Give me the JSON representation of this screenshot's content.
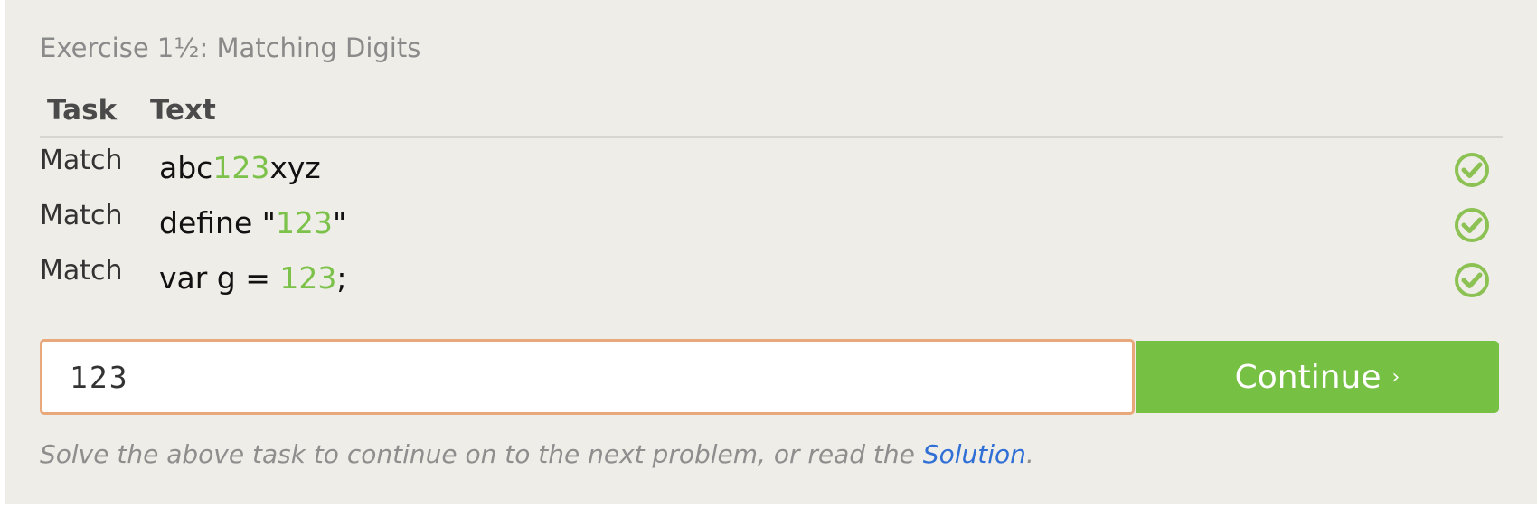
{
  "exercise": {
    "title": "Exercise 1½: Matching Digits"
  },
  "table": {
    "headers": {
      "task": "Task",
      "text": "Text"
    },
    "rows": [
      {
        "task": "Match",
        "pre": "abc",
        "match": "123",
        "post": "xyz",
        "status": "check-circle-icon"
      },
      {
        "task": "Match",
        "pre": "define \"",
        "match": "123",
        "post": "\"",
        "status": "check-circle-icon"
      },
      {
        "task": "Match",
        "pre": "var g = ",
        "match": "123",
        "post": ";",
        "status": "check-circle-icon"
      }
    ]
  },
  "input": {
    "value": "123"
  },
  "continue_button": {
    "label": "Continue",
    "chevron": "›"
  },
  "hint": {
    "prefix": "Solve the above task to continue on to the next problem, or read the ",
    "link": "Solution",
    "suffix": "."
  },
  "colors": {
    "match_highlight": "#7cc24a",
    "button": "#76c043",
    "input_border": "#e8a87c",
    "link": "#2f6fd6",
    "panel": "#efede7"
  }
}
